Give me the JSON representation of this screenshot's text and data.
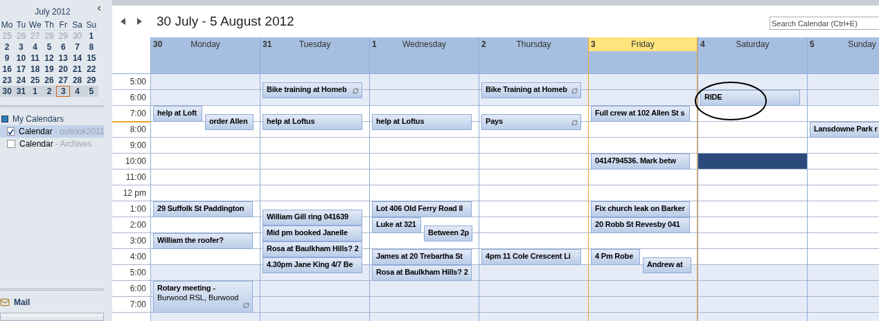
{
  "mini_calendar": {
    "month": "July 2012",
    "weekdays": [
      "Mo",
      "Tu",
      "We",
      "Th",
      "Fr",
      "Sa",
      "Su"
    ],
    "weeks": [
      {
        "selected": false,
        "days": [
          {
            "label": "25",
            "dimmed": true,
            "today": false
          },
          {
            "label": "26",
            "dimmed": true,
            "today": false
          },
          {
            "label": "27",
            "dimmed": true,
            "today": false
          },
          {
            "label": "28",
            "dimmed": true,
            "today": false
          },
          {
            "label": "29",
            "dimmed": true,
            "today": false
          },
          {
            "label": "30",
            "dimmed": true,
            "today": false
          },
          {
            "label": "1",
            "dimmed": false,
            "today": false
          }
        ]
      },
      {
        "selected": false,
        "days": [
          {
            "label": "2",
            "dimmed": false,
            "today": false
          },
          {
            "label": "3",
            "dimmed": false,
            "today": false
          },
          {
            "label": "4",
            "dimmed": false,
            "today": false
          },
          {
            "label": "5",
            "dimmed": false,
            "today": false
          },
          {
            "label": "6",
            "dimmed": false,
            "today": false
          },
          {
            "label": "7",
            "dimmed": false,
            "today": false
          },
          {
            "label": "8",
            "dimmed": false,
            "today": false
          }
        ]
      },
      {
        "selected": false,
        "days": [
          {
            "label": "9",
            "dimmed": false,
            "today": false
          },
          {
            "label": "10",
            "dimmed": false,
            "today": false
          },
          {
            "label": "11",
            "dimmed": false,
            "today": false
          },
          {
            "label": "12",
            "dimmed": false,
            "today": false
          },
          {
            "label": "13",
            "dimmed": false,
            "today": false
          },
          {
            "label": "14",
            "dimmed": false,
            "today": false
          },
          {
            "label": "15",
            "dimmed": false,
            "today": false
          }
        ]
      },
      {
        "selected": false,
        "days": [
          {
            "label": "16",
            "dimmed": false,
            "today": false
          },
          {
            "label": "17",
            "dimmed": false,
            "today": false
          },
          {
            "label": "18",
            "dimmed": false,
            "today": false
          },
          {
            "label": "19",
            "dimmed": false,
            "today": false
          },
          {
            "label": "20",
            "dimmed": false,
            "today": false
          },
          {
            "label": "21",
            "dimmed": false,
            "today": false
          },
          {
            "label": "22",
            "dimmed": false,
            "today": false
          }
        ]
      },
      {
        "selected": false,
        "days": [
          {
            "label": "23",
            "dimmed": false,
            "today": false
          },
          {
            "label": "24",
            "dimmed": false,
            "today": false
          },
          {
            "label": "25",
            "dimmed": false,
            "today": false
          },
          {
            "label": "26",
            "dimmed": false,
            "today": false
          },
          {
            "label": "27",
            "dimmed": false,
            "today": false
          },
          {
            "label": "28",
            "dimmed": false,
            "today": false
          },
          {
            "label": "29",
            "dimmed": false,
            "today": false
          }
        ]
      },
      {
        "selected": true,
        "days": [
          {
            "label": "30",
            "dimmed": false,
            "today": false
          },
          {
            "label": "31",
            "dimmed": false,
            "today": false
          },
          {
            "label": "1",
            "dimmed": false,
            "today": false
          },
          {
            "label": "2",
            "dimmed": false,
            "today": false
          },
          {
            "label": "3",
            "dimmed": false,
            "today": true
          },
          {
            "label": "4",
            "dimmed": false,
            "today": false
          },
          {
            "label": "5",
            "dimmed": false,
            "today": false
          }
        ]
      }
    ]
  },
  "calendar_group": {
    "title": "My Calendars",
    "items": [
      {
        "name": "Calendar",
        "account": "- outlook2011",
        "checked": true,
        "selected": true
      },
      {
        "name": "Calendar",
        "account": "- Archives",
        "checked": false,
        "selected": false
      }
    ]
  },
  "navigation": [
    {
      "label": "Mail",
      "kind": "mail"
    }
  ],
  "header": {
    "title": "30 July - 5 August 2012",
    "search": {
      "placeholder": "Search Calendar (Ctrl+E)"
    }
  },
  "time_labels": [
    "5:00",
    "6:00",
    "7:00",
    "8:00",
    "9:00",
    "10:00",
    "11:00",
    "12 pm",
    "1:00",
    "2:00",
    "3:00",
    "4:00",
    "5:00",
    "6:00",
    "7:00"
  ],
  "days": [
    {
      "date": "30",
      "name": "Monday",
      "today": false,
      "slot_selected": false,
      "events": [
        {
          "title": "help at Loft",
          "recurring": false,
          "circled": false
        },
        {
          "title": "order Allen",
          "recurring": false,
          "circled": false
        },
        {
          "title": "29 Suffolk St Paddington",
          "recurring": false,
          "circled": false
        },
        {
          "title": "William the roofer?",
          "recurring": false,
          "circled": false
        },
        {
          "title": "Rotary meeting -",
          "location": "Burwood RSL, Burwood",
          "recurring": true,
          "circled": false
        }
      ]
    },
    {
      "date": "31",
      "name": "Tuesday",
      "today": false,
      "slot_selected": false,
      "events": [
        {
          "title": "Bike training at Homeb",
          "recurring": true,
          "circled": false
        },
        {
          "title": "help at Loftus",
          "recurring": false,
          "circled": false
        },
        {
          "title": "William Gill  ring  041639",
          "recurring": false,
          "circled": false
        },
        {
          "title": "Mid pm  booked Janelle",
          "recurring": false,
          "circled": false
        },
        {
          "title": "Rosa at Baulkham Hills? 2",
          "recurring": false,
          "circled": false
        },
        {
          "title": "4.30pm  Jane King 4/7 Be",
          "recurring": false,
          "circled": false
        }
      ]
    },
    {
      "date": "1",
      "name": "Wednesday",
      "today": false,
      "slot_selected": false,
      "events": [
        {
          "title": "help at Loftus",
          "recurring": false,
          "circled": false
        },
        {
          "title": "Lot 406 Old Ferry Road  Il",
          "recurring": false,
          "circled": false
        },
        {
          "title": "Luke at 321",
          "recurring": false,
          "circled": false
        },
        {
          "title": "Between 2p",
          "recurring": false,
          "circled": false
        },
        {
          "title": "James at 20 Trebartha St",
          "recurring": false,
          "circled": false
        },
        {
          "title": "Rosa at Baulkham Hills? 2",
          "recurring": false,
          "circled": false
        }
      ]
    },
    {
      "date": "2",
      "name": "Thursday",
      "today": false,
      "slot_selected": false,
      "events": [
        {
          "title": "Bike Training at Homeb",
          "recurring": true,
          "circled": false
        },
        {
          "title": "Pays",
          "recurring": true,
          "circled": false
        },
        {
          "title": "4pm  11 Cole Crescent  Li",
          "recurring": false,
          "circled": false
        }
      ]
    },
    {
      "date": "3",
      "name": "Friday",
      "today": true,
      "slot_selected": false,
      "events": [
        {
          "title": "Full crew at 102 Allen St s",
          "recurring": false,
          "circled": false
        },
        {
          "title": "0414794536.  Mark  betw",
          "recurring": false,
          "circled": false
        },
        {
          "title": "Fix church leak on Barker",
          "recurring": false,
          "circled": false
        },
        {
          "title": "20 Robb St  Revesby  041",
          "recurring": false,
          "circled": false
        },
        {
          "title": "4 Pm  Robe",
          "recurring": false,
          "circled": false
        },
        {
          "title": "Andrew at",
          "recurring": false,
          "circled": false
        }
      ]
    },
    {
      "date": "4",
      "name": "Saturday",
      "today": false,
      "slot_selected": true,
      "events": [
        {
          "title": "RIDE",
          "recurring": false,
          "circled": true
        }
      ]
    },
    {
      "date": "5",
      "name": "Sunday",
      "today": false,
      "slot_selected": false,
      "events": [
        {
          "title": "Lansdowne Park r",
          "circled": false
        }
      ]
    }
  ]
}
